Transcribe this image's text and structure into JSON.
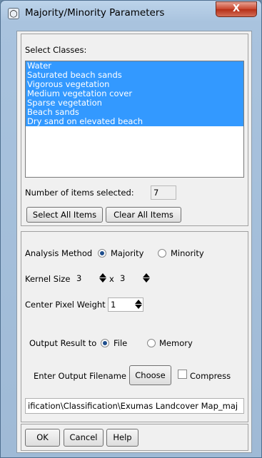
{
  "window": {
    "title": "Majority/Minority Parameters",
    "close_label": "X"
  },
  "select_classes": {
    "label": "Select Classes:",
    "items": [
      "Water",
      "Saturated beach sands",
      "Vigorous vegetation",
      "Medium vegetation cover",
      "Sparse vegetation",
      "Beach sands",
      "Dry sand on elevated beach"
    ],
    "count_label": "Number of items selected:",
    "count_value": "7",
    "select_all_label": "Select All Items",
    "clear_all_label": "Clear All Items"
  },
  "analysis": {
    "label": "Analysis Method",
    "options": [
      "Majority",
      "Minority"
    ],
    "selected": "Majority"
  },
  "kernel": {
    "label": "Kernel Size",
    "width": "3",
    "separator": "x",
    "height": "3"
  },
  "center_weight": {
    "label": "Center Pixel Weight",
    "value": "1"
  },
  "output": {
    "label": "Output Result to",
    "options": [
      "File",
      "Memory"
    ],
    "selected": "File",
    "filename_label": "Enter Output Filename",
    "choose_label": "Choose",
    "compress_label": "Compress",
    "compress_checked": false,
    "filename_value": "ification\\Classification\\Exumas Landcover Map_maj"
  },
  "footer": {
    "ok_label": "OK",
    "cancel_label": "Cancel",
    "help_label": "Help"
  },
  "colors": {
    "selection": "#3399ff",
    "window_frame": "#a9c3de",
    "close_button": "#c8442b"
  }
}
